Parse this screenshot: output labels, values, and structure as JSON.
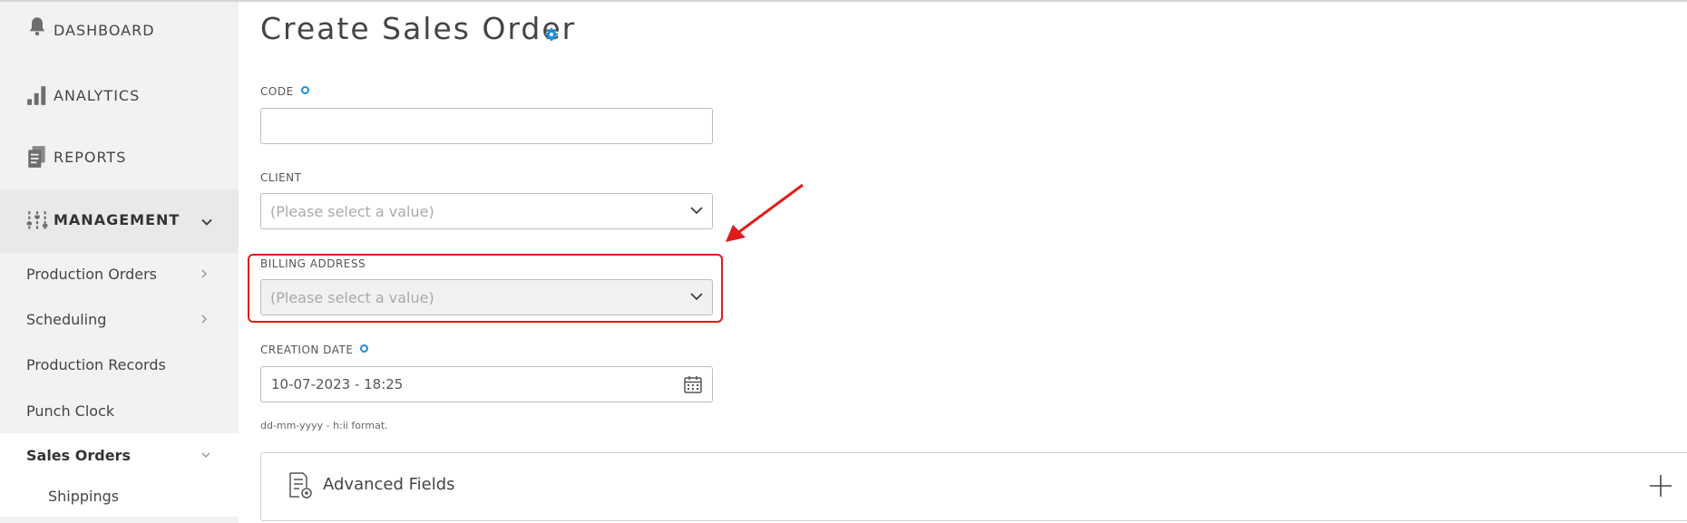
{
  "sidebar": {
    "main": [
      {
        "label": "DASHBOARD",
        "icon": "bell-icon"
      },
      {
        "label": "ANALYTICS",
        "icon": "bar-chart-icon"
      },
      {
        "label": "REPORTS",
        "icon": "document-icon"
      },
      {
        "label": "MANAGEMENT",
        "icon": "sliders-icon"
      }
    ],
    "submenu": [
      {
        "label": "Production Orders"
      },
      {
        "label": "Scheduling"
      },
      {
        "label": "Production Records"
      },
      {
        "label": "Punch Clock"
      },
      {
        "label": "Sales Orders"
      },
      {
        "label": "Shippings"
      }
    ]
  },
  "page": {
    "title": "Create Sales Order"
  },
  "form": {
    "code": {
      "label": "CODE",
      "value": ""
    },
    "client": {
      "label": "CLIENT",
      "placeholder": "(Please select a value)"
    },
    "billing_address": {
      "label": "BILLING ADDRESS",
      "placeholder": "(Please select a value)"
    },
    "creation_date": {
      "label": "CREATION DATE",
      "value": "10-07-2023 - 18:25",
      "hint": "dd-mm-yyyy - h:ii format."
    }
  },
  "advanced": {
    "label": "Advanced Fields"
  },
  "colors": {
    "accent": "#1e8fd6",
    "annotation": "#e11b1b"
  }
}
